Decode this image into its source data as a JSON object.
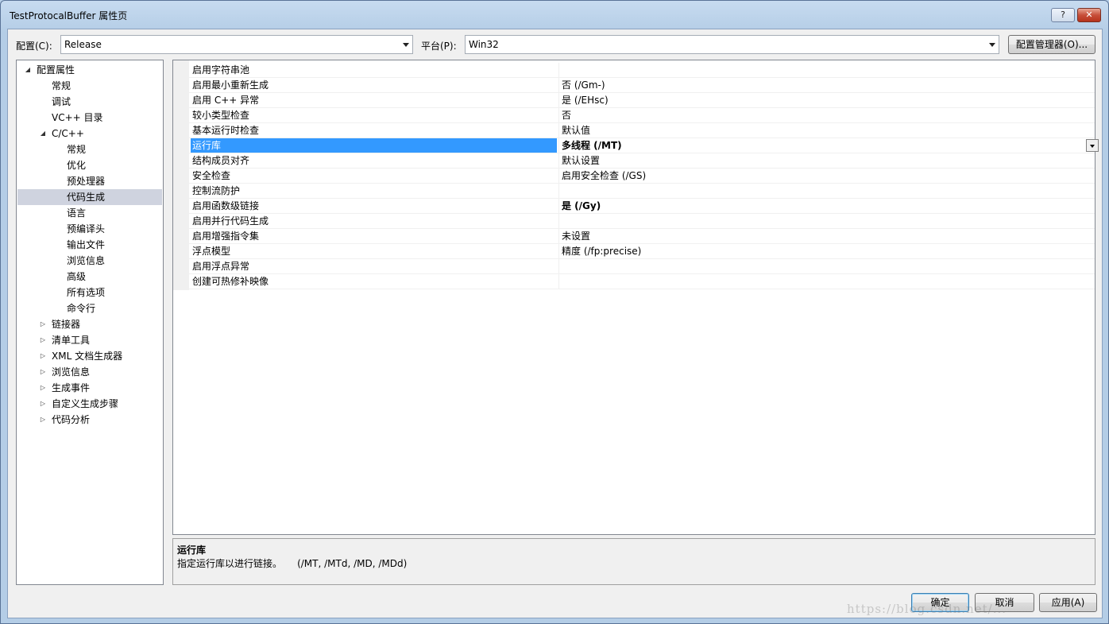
{
  "window": {
    "title": "TestProtocalBuffer 属性页",
    "help_label": "?",
    "close_label": "✕"
  },
  "config": {
    "config_label": "配置(C):",
    "config_value": "Release",
    "platform_label": "平台(P):",
    "platform_value": "Win32",
    "manager_label": "配置管理器(O)..."
  },
  "tree": {
    "items": [
      {
        "label": "配置属性",
        "level": 0,
        "expander": "expanded"
      },
      {
        "label": "常规",
        "level": 1
      },
      {
        "label": "调试",
        "level": 1
      },
      {
        "label": "VC++ 目录",
        "level": 1
      },
      {
        "label": "C/C++",
        "level": 1,
        "expander": "expanded"
      },
      {
        "label": "常规",
        "level": 2
      },
      {
        "label": "优化",
        "level": 2
      },
      {
        "label": "预处理器",
        "level": 2
      },
      {
        "label": "代码生成",
        "level": 2,
        "selected": true
      },
      {
        "label": "语言",
        "level": 2
      },
      {
        "label": "预编译头",
        "level": 2
      },
      {
        "label": "输出文件",
        "level": 2
      },
      {
        "label": "浏览信息",
        "level": 2
      },
      {
        "label": "高级",
        "level": 2
      },
      {
        "label": "所有选项",
        "level": 2
      },
      {
        "label": "命令行",
        "level": 2
      },
      {
        "label": "链接器",
        "level": 1,
        "expander": "collapsed"
      },
      {
        "label": "清单工具",
        "level": 1,
        "expander": "collapsed"
      },
      {
        "label": "XML 文档生成器",
        "level": 1,
        "expander": "collapsed"
      },
      {
        "label": "浏览信息",
        "level": 1,
        "expander": "collapsed"
      },
      {
        "label": "生成事件",
        "level": 1,
        "expander": "collapsed"
      },
      {
        "label": "自定义生成步骤",
        "level": 1,
        "expander": "collapsed"
      },
      {
        "label": "代码分析",
        "level": 1,
        "expander": "collapsed"
      }
    ]
  },
  "properties": [
    {
      "name": "启用字符串池",
      "value": ""
    },
    {
      "name": "启用最小重新生成",
      "value": "否 (/Gm-)"
    },
    {
      "name": "启用 C++ 异常",
      "value": "是 (/EHsc)"
    },
    {
      "name": "较小类型检查",
      "value": "否"
    },
    {
      "name": "基本运行时检查",
      "value": "默认值"
    },
    {
      "name": "运行库",
      "value": "多线程 (/MT)",
      "bold": true,
      "selected": true
    },
    {
      "name": "结构成员对齐",
      "value": "默认设置"
    },
    {
      "name": "安全检查",
      "value": "启用安全检查 (/GS)"
    },
    {
      "name": "控制流防护",
      "value": ""
    },
    {
      "name": "启用函数级链接",
      "value": "是 (/Gy)",
      "bold": true
    },
    {
      "name": "启用并行代码生成",
      "value": ""
    },
    {
      "name": "启用增强指令集",
      "value": "未设置"
    },
    {
      "name": "浮点模型",
      "value": "精度 (/fp:precise)"
    },
    {
      "name": "启用浮点异常",
      "value": ""
    },
    {
      "name": "创建可热修补映像",
      "value": ""
    }
  ],
  "description": {
    "title": "运行库",
    "text": "指定运行库以进行链接。     (/MT, /MTd, /MD, /MDd)"
  },
  "buttons": {
    "ok": "确定",
    "cancel": "取消",
    "apply": "应用(A)"
  },
  "watermark": "https://blog.csdn.net/..."
}
